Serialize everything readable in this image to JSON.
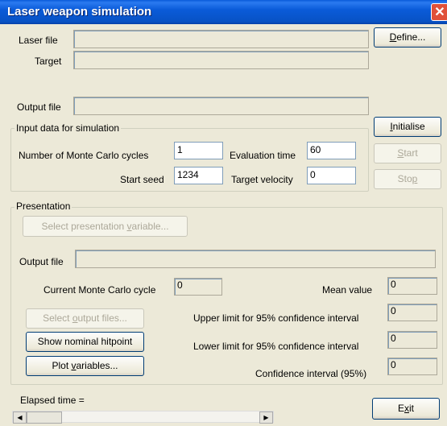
{
  "window": {
    "title": "Laser weapon simulation"
  },
  "files": {
    "laser_label": "Laser file",
    "target_label": "Target",
    "output_label": "Output file",
    "define_button": "Define..."
  },
  "input_group": {
    "title": "Input data for simulation",
    "mc_cycles_label": "Number of Monte Carlo cycles",
    "mc_cycles_value": "1",
    "eval_time_label": "Evaluation time",
    "eval_time_value": "60",
    "start_seed_label": "Start seed",
    "start_seed_value": "1234",
    "target_velocity_label": "Target velocity",
    "target_velocity_value": "0"
  },
  "actions": {
    "initialise": "Initialise",
    "start": "Start",
    "stop": "Stop"
  },
  "presentation": {
    "title": "Presentation",
    "select_variable_button": "Select presentation variable...",
    "output_file_label": "Output file",
    "current_cycle_label": "Current Monte Carlo cycle",
    "current_cycle_value": "0",
    "mean_value_label": "Mean value",
    "mean_value": "0",
    "upper_limit_label": "Upper limit for 95% confidence interval",
    "upper_limit_value": "0",
    "lower_limit_label": "Lower limit for 95% confidence interval",
    "lower_limit_value": "0",
    "confidence_label": "Confidence interval (95%)",
    "confidence_value": "0",
    "select_output_files_button": "Select output files...",
    "show_hitpoint_button": "Show nominal hitpoint",
    "plot_variables_button": "Plot variables..."
  },
  "status": {
    "elapsed_label": "Elapsed time ="
  },
  "exit_button": "Exit",
  "colors": {
    "title_bar": "#0a5bd9",
    "close_button": "#e0513a",
    "window_bg": "#ece9d8"
  }
}
